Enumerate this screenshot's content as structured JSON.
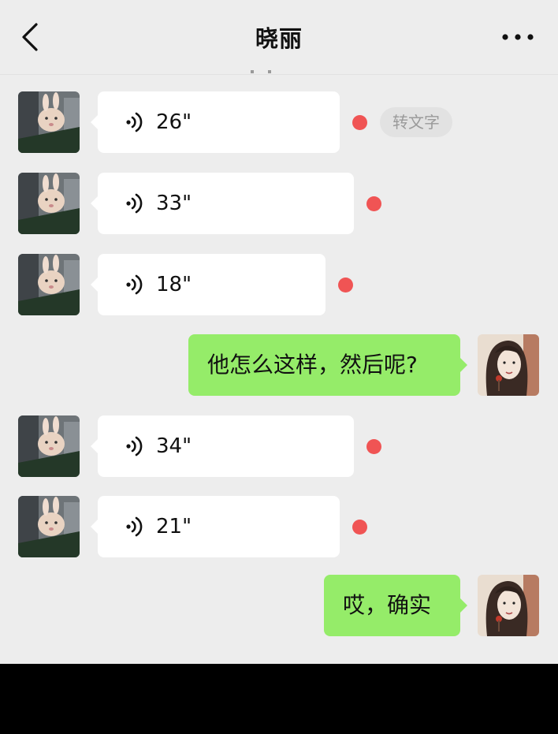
{
  "header": {
    "title": "晓丽",
    "back_icon": "chevron-left-icon",
    "more_icon": "more-dots-icon"
  },
  "colors": {
    "background": "#ededed",
    "incoming_bubble": "#ffffff",
    "outgoing_bubble": "#95ec69",
    "unread_dot": "#f05454",
    "to_text_bg": "#e2e2e2",
    "to_text_fg": "#9a9a9a"
  },
  "messages": [
    {
      "type": "voice",
      "direction": "in",
      "duration": "26\"",
      "unread": true,
      "to_text_label": "转文字"
    },
    {
      "type": "voice",
      "direction": "in",
      "duration": "33\"",
      "unread": true
    },
    {
      "type": "voice",
      "direction": "in",
      "duration": "18\"",
      "unread": true
    },
    {
      "type": "text",
      "direction": "out",
      "text": "他怎么这样，然后呢?"
    },
    {
      "type": "voice",
      "direction": "in",
      "duration": "34\"",
      "unread": true
    },
    {
      "type": "voice",
      "direction": "in",
      "duration": "21\"",
      "unread": true
    },
    {
      "type": "text",
      "direction": "out",
      "text": "哎，确实"
    }
  ]
}
